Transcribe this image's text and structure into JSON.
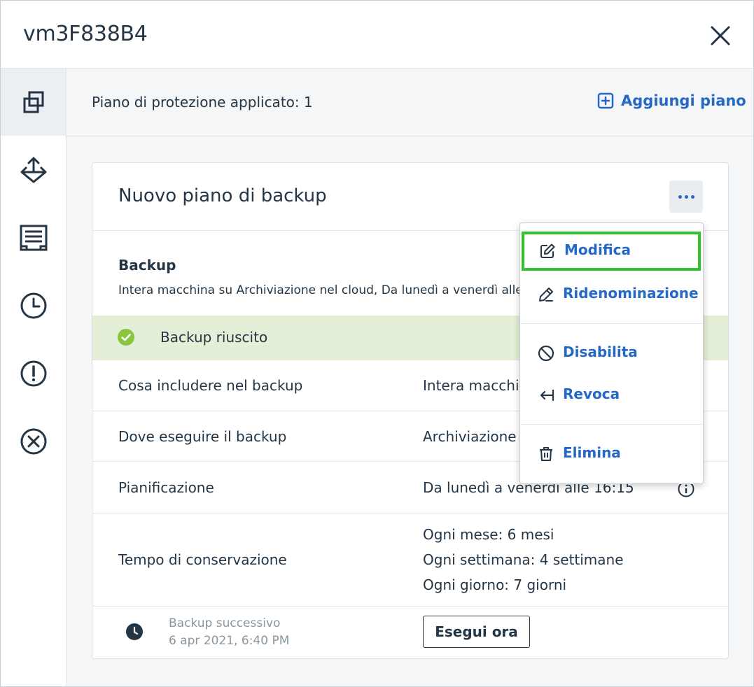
{
  "window": {
    "title": "vm3F838B4"
  },
  "topbar": {
    "applied_label": "Piano di protezione applicato: 1",
    "add_plan_label": "Aggiungi piano"
  },
  "card": {
    "title": "Nuovo piano di backup",
    "section_title": "Backup",
    "section_desc": "Intera macchina su Archiviazione nel cloud, Da lunedì a venerdì alle 1",
    "status": "Backup riuscito",
    "rows": {
      "what": {
        "label": "Cosa includere nel backup",
        "value": "Intera macchin"
      },
      "where": {
        "label": "Dove eseguire il backup",
        "value": "Archiviazione"
      },
      "schedule": {
        "label": "Pianificazione",
        "value": "Da lunedì a venerdì alle 16:15"
      },
      "retention": {
        "label": "Tempo di conservazione",
        "values": [
          "Ogni mese: 6 mesi",
          "Ogni settimana: 4 settimane",
          "Ogni giorno: 7 giorni"
        ]
      }
    },
    "next_backup_label": "Backup successivo",
    "next_backup_date": "6 apr 2021, 6:40 PM",
    "run_now_label": "Esegui ora"
  },
  "menu": {
    "edit": "Modifica",
    "rename": "Ridenominazione",
    "disable": "Disabilita",
    "revoke": "Revoca",
    "delete": "Elimina"
  },
  "sidebar": {
    "icons": [
      "copy-icon",
      "recovery-icon",
      "activities-icon",
      "history-icon",
      "alert-icon",
      "cancel-icon"
    ]
  },
  "colors": {
    "accent": "#2668c5",
    "status_bg": "#e4efd7",
    "success": "#8cc63f",
    "highlight": "#2fc42b"
  }
}
